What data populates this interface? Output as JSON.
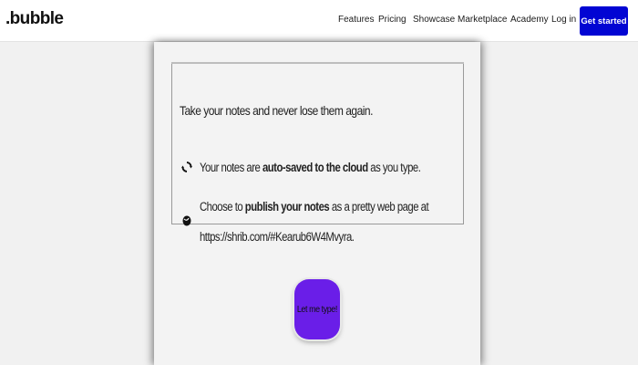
{
  "header": {
    "logo": ".bubble",
    "nav": [
      "Features",
      "Pricing",
      "Showcase",
      "Marketplace",
      "Academy"
    ],
    "login": "Log in",
    "cta": "Get started"
  },
  "note": {
    "intro": "Take your notes and never lose them again.",
    "feature1": {
      "pre": "Your notes are ",
      "bold": "auto-saved to the cloud",
      "post": " as you type.",
      "icon": "sync-icon"
    },
    "feature2": {
      "pre": "Choose to ",
      "bold": "publish your notes",
      "post": " as a pretty web page at",
      "line2": "https://shrib.com/#Kearub6W4Mvyra.",
      "icon": "globe-icon"
    },
    "button": "Let me type!"
  },
  "colors": {
    "cta_bg": "#0205d3",
    "button_bg": "#6a1ee8"
  }
}
